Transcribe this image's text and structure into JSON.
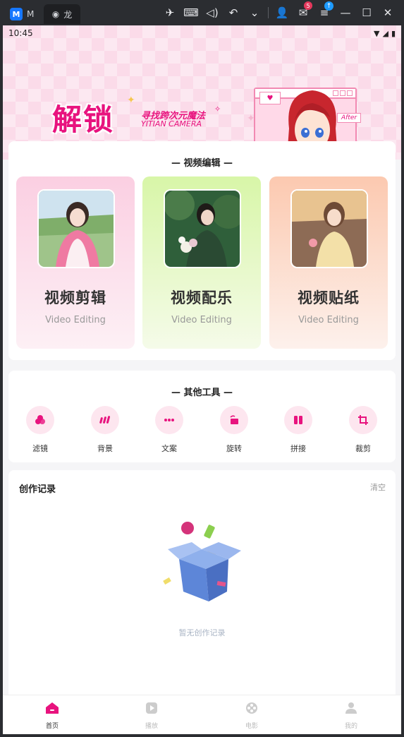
{
  "host": {
    "tab1_label": "M",
    "tab2_label": "龙",
    "mail_badge": "5"
  },
  "status": {
    "time": "10:45"
  },
  "banner": {
    "title": "解锁",
    "subtitle_cn": "寻找跨次元魔法",
    "subtitle_en": "YITIAN CAMERA",
    "after_label": "After",
    "heart": "♥"
  },
  "video_edit": {
    "title": "— 视频编辑 —",
    "cards": [
      {
        "title": "视频剪辑",
        "subtitle": "Video Editing",
        "bg_top": "#fbcfe2",
        "bg_bottom": "#fdf0f5"
      },
      {
        "title": "视频配乐",
        "subtitle": "Video Editing",
        "bg_top": "#d8f6a8",
        "bg_bottom": "#f5fbe9"
      },
      {
        "title": "视频贴纸",
        "subtitle": "Video Editing",
        "bg_top": "#fcc9b0",
        "bg_bottom": "#fdf1ec"
      }
    ]
  },
  "other_tools": {
    "title": "— 其他工具 —",
    "items": [
      {
        "label": "滤镜",
        "icon": "filter-icon"
      },
      {
        "label": "背景",
        "icon": "background-icon"
      },
      {
        "label": "文案",
        "icon": "text-icon"
      },
      {
        "label": "旋转",
        "icon": "rotate-icon"
      },
      {
        "label": "拼接",
        "icon": "splice-icon"
      },
      {
        "label": "裁剪",
        "icon": "crop-icon"
      }
    ]
  },
  "records": {
    "title": "创作记录",
    "clear_label": "清空",
    "empty_text": "暂无创作记录"
  },
  "tabbar": {
    "items": [
      {
        "label": "首页",
        "active": true
      },
      {
        "label": "播放",
        "active": false
      },
      {
        "label": "电影",
        "active": false
      },
      {
        "label": "我的",
        "active": false
      }
    ]
  },
  "colors": {
    "accent": "#e8137e",
    "tab_active": "#e8137e",
    "tab_inactive": "#cccccc"
  }
}
